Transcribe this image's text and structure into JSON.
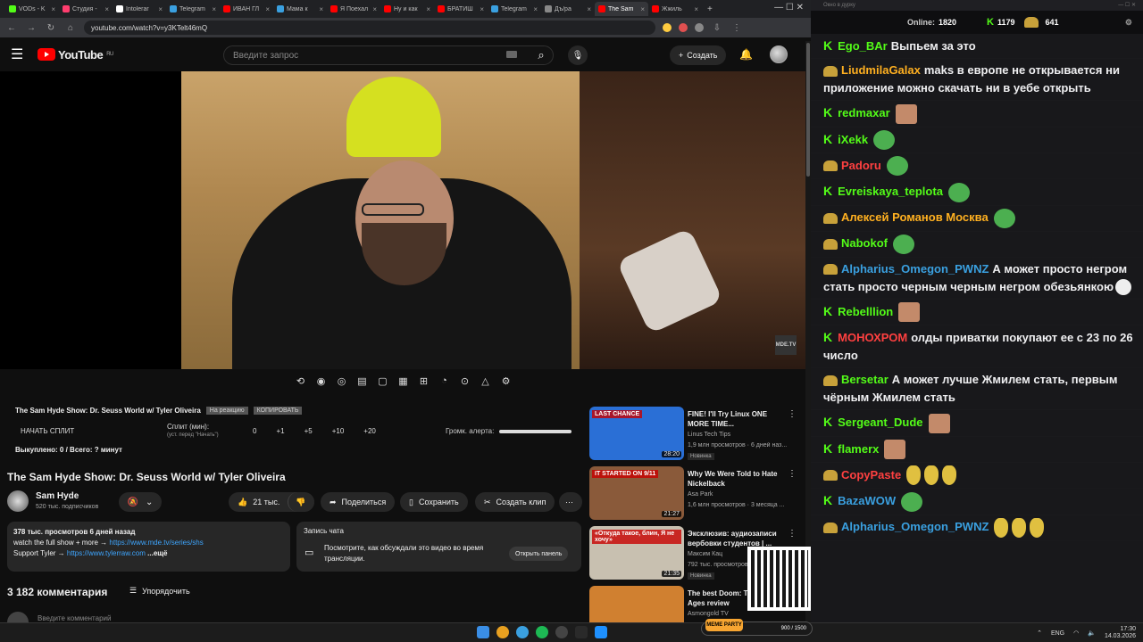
{
  "browser": {
    "tabs": [
      {
        "label": "VODs - K",
        "color": "#53fc18"
      },
      {
        "label": "Студия -",
        "color": "#ff3d6e"
      },
      {
        "label": "Intolerar",
        "color": "#ffffff"
      },
      {
        "label": "Telegram",
        "color": "#3aa0e0"
      },
      {
        "label": "ИВАН ГЛ",
        "color": "#ff0000"
      },
      {
        "label": "Мама к",
        "color": "#3aa0e0"
      },
      {
        "label": "Я Поехал",
        "color": "#ff0000"
      },
      {
        "label": "Ну и как",
        "color": "#ff0000"
      },
      {
        "label": "БРАТИШ",
        "color": "#ff0000"
      },
      {
        "label": "Telegram",
        "color": "#3aa0e0"
      },
      {
        "label": "Дъ/ра",
        "color": "#888888"
      },
      {
        "label": "The Sam",
        "color": "#ff0000",
        "active": true
      },
      {
        "label": "Жжиль",
        "color": "#ff0000"
      }
    ],
    "url": "youtube.com/watch?v=y3KTelt46mQ"
  },
  "youtube": {
    "logo": "YouTube",
    "region": "RU",
    "search_placeholder": "Введите запрос",
    "create_label": "Создать",
    "split": {
      "title": "The Sam Hyde Show: Dr. Seuss World w/ Tyler Oliveira",
      "tag1": "На реакцию",
      "tag2": "КОПИРОВАТЬ",
      "start_split": "НАЧАТЬ СПЛИТ",
      "split_label": "Сплит (мин):",
      "split_sub": "(уст. перед \"Начать\")",
      "val0": "0",
      "val1": "+1",
      "val2": "+5",
      "val3": "+10",
      "val4": "+20",
      "alert_label": "Громк. алерта:",
      "spent": "Выкуплено: 0 / Всего: ? минут"
    },
    "video_title": "The Sam Hyde Show: Dr. Seuss World w/ Tyler Oliveira",
    "channel": {
      "name": "Sam Hyde",
      "subs": "520 тыс. подписчиков"
    },
    "actions": {
      "likes": "21 тыс.",
      "share": "Поделиться",
      "save": "Сохранить",
      "clip": "Создать клип"
    },
    "description": {
      "stats": "378 тыс. просмотров  6 дней назад",
      "line1_prefix": "watch the full show + more → ",
      "line1_link": "https://www.mde.tv/series/shs",
      "line2_prefix": "Support Tyler → ",
      "line2_link": "https://www.tylerraw.com",
      "more": " ...ещё"
    },
    "chat_replay": {
      "title": "Запись чата",
      "text": "Посмотрите, как обсуждали это видео во время трансляции.",
      "button": "Открыть панель"
    },
    "comments_count": "3 182 комментария",
    "sort_label": "Упорядочить",
    "comment_placeholder": "Введите комментарий",
    "recs": [
      {
        "title": "FINE! I'll Try Linux ONE MORE TIME...",
        "channel": "Linus Tech Tips",
        "meta": "1,9 млн просмотров · 6 дней наз...",
        "badge": "Новинка",
        "duration": "28:20",
        "overlay": "LAST CHANCE",
        "color": "#2a6fd6"
      },
      {
        "title": "Why We Were Told to Hate Nickelback",
        "channel": "Asa Park",
        "meta": "1,6 млн просмотров · 3 месяца ...",
        "badge": "",
        "duration": "21:27",
        "overlay": "IT STARTED ON 9/11",
        "color": "#8a5a3a"
      },
      {
        "title": "Эксклюзив: аудиозаписи вербовки студентов | ...",
        "channel": "Максим Кац",
        "meta": "792 тыс. просмотров · 3 ...",
        "badge": "Новинка",
        "duration": "21:35",
        "overlay": "«Откуда такое, блин, Я не хочу»",
        "color": "#c8c0b0"
      },
      {
        "title": "The best Doom: The Dark Ages review",
        "channel": "Asmongold TV",
        "meta": "",
        "badge": "",
        "duration": "",
        "overlay": "",
        "color": "#d08030"
      }
    ]
  },
  "chat": {
    "window_title": "Окно в дурку",
    "online_label": "Online:",
    "online_value": "1820",
    "kick_count": "1179",
    "coin_count": "641",
    "messages": [
      {
        "badge": "k",
        "user": "Ego_BAr",
        "color": "#53fc18",
        "text": "Выпьем за это"
      },
      {
        "badge": "coin",
        "user": "LiudmilaGalax",
        "color": "#ffb020",
        "text": "maks в европе не открывается ни приложение можно скачать ни в уебе открыть"
      },
      {
        "badge": "k",
        "user": "redmaxar",
        "color": "#53fc18",
        "text": "",
        "emote": "face"
      },
      {
        "badge": "k",
        "user": "iXekk",
        "color": "#53fc18",
        "text": "",
        "emote": "pepe"
      },
      {
        "badge": "coin",
        "user": "Padoru",
        "color": "#ff4040",
        "text": "",
        "emote": "pepe"
      },
      {
        "badge": "k",
        "user": "Evreiskaya_teplota",
        "color": "#53fc18",
        "text": "",
        "emote": "pepe"
      },
      {
        "badge": "coin",
        "user": "Алексей Романов Москва",
        "color": "#ffb020",
        "text": "",
        "emote": "pepe"
      },
      {
        "badge": "coin",
        "user": "Nabokof",
        "color": "#53fc18",
        "text": "",
        "emote": "pepe"
      },
      {
        "badge": "coin",
        "user": "Alpharius_Omegon_PWNZ",
        "color": "#3aa0e0",
        "text": "А может просто негром стать просто черным черным негром обезьянкою",
        "emote": "cat"
      },
      {
        "badge": "k",
        "user": "Rebelllion",
        "color": "#53fc18",
        "text": "",
        "emote": "face"
      },
      {
        "badge": "k",
        "user": "МОНОХРОМ",
        "color": "#ff4040",
        "text": "олды приватки покупают ее с 23 по 26 число"
      },
      {
        "badge": "coin",
        "user": "Bersetar",
        "color": "#53fc18",
        "text": "А может лучше Жмилем стать, первым чёрным Жмилем стать"
      },
      {
        "badge": "k",
        "user": "Sergeant_Dude",
        "color": "#53fc18",
        "text": "",
        "emote": "face"
      },
      {
        "badge": "k",
        "user": "flamerx",
        "color": "#53fc18",
        "text": "",
        "emote": "face"
      },
      {
        "badge": "coin",
        "user": "CopyPaste",
        "color": "#ff4040",
        "text": "",
        "emote": "banana3"
      },
      {
        "badge": "k",
        "user": "BazaWOW",
        "color": "#3aa0e0",
        "text": "",
        "emote": "pepe"
      },
      {
        "badge": "coin",
        "user": "Alpharius_Omegon_PWNZ",
        "color": "#3aa0e0",
        "text": "",
        "emote": "banana3"
      }
    ]
  },
  "taskbar": {
    "meme_label": "MEME PARTY",
    "meme_progress": "900 / 1500",
    "lang": "ENG",
    "time": "17:30",
    "date": "14.03.2026"
  }
}
